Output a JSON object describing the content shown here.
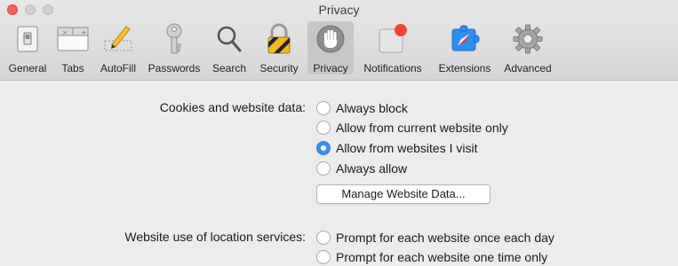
{
  "window": {
    "title": "Privacy"
  },
  "toolbar": {
    "tabs": [
      {
        "label": "General",
        "icon": "general-switch-icon"
      },
      {
        "label": "Tabs",
        "icon": "tabs-icon"
      },
      {
        "label": "AutoFill",
        "icon": "pencil-form-icon"
      },
      {
        "label": "Passwords",
        "icon": "key-icon"
      },
      {
        "label": "Search",
        "icon": "search-icon"
      },
      {
        "label": "Security",
        "icon": "lock-icon"
      },
      {
        "label": "Privacy",
        "icon": "hand-icon",
        "selected": true
      },
      {
        "label": "Notifications",
        "icon": "notification-badge-icon"
      },
      {
        "label": "Extensions",
        "icon": "puzzle-compass-icon"
      },
      {
        "label": "Advanced",
        "icon": "gear-icon"
      }
    ]
  },
  "cookies": {
    "label": "Cookies and website data:",
    "options": [
      {
        "label": "Always block",
        "checked": false
      },
      {
        "label": "Allow from current website only",
        "checked": false
      },
      {
        "label": "Allow from websites I visit",
        "checked": true
      },
      {
        "label": "Always allow",
        "checked": false
      }
    ],
    "manage_button": "Manage Website Data..."
  },
  "location": {
    "label": "Website use of location services:",
    "options": [
      {
        "label": "Prompt for each website once each day",
        "checked": false
      },
      {
        "label": "Prompt for each website one time only",
        "checked": false
      }
    ]
  },
  "colors": {
    "accent": "#3d8ff6",
    "close": "#fc605b",
    "notification_badge": "#f44336"
  }
}
